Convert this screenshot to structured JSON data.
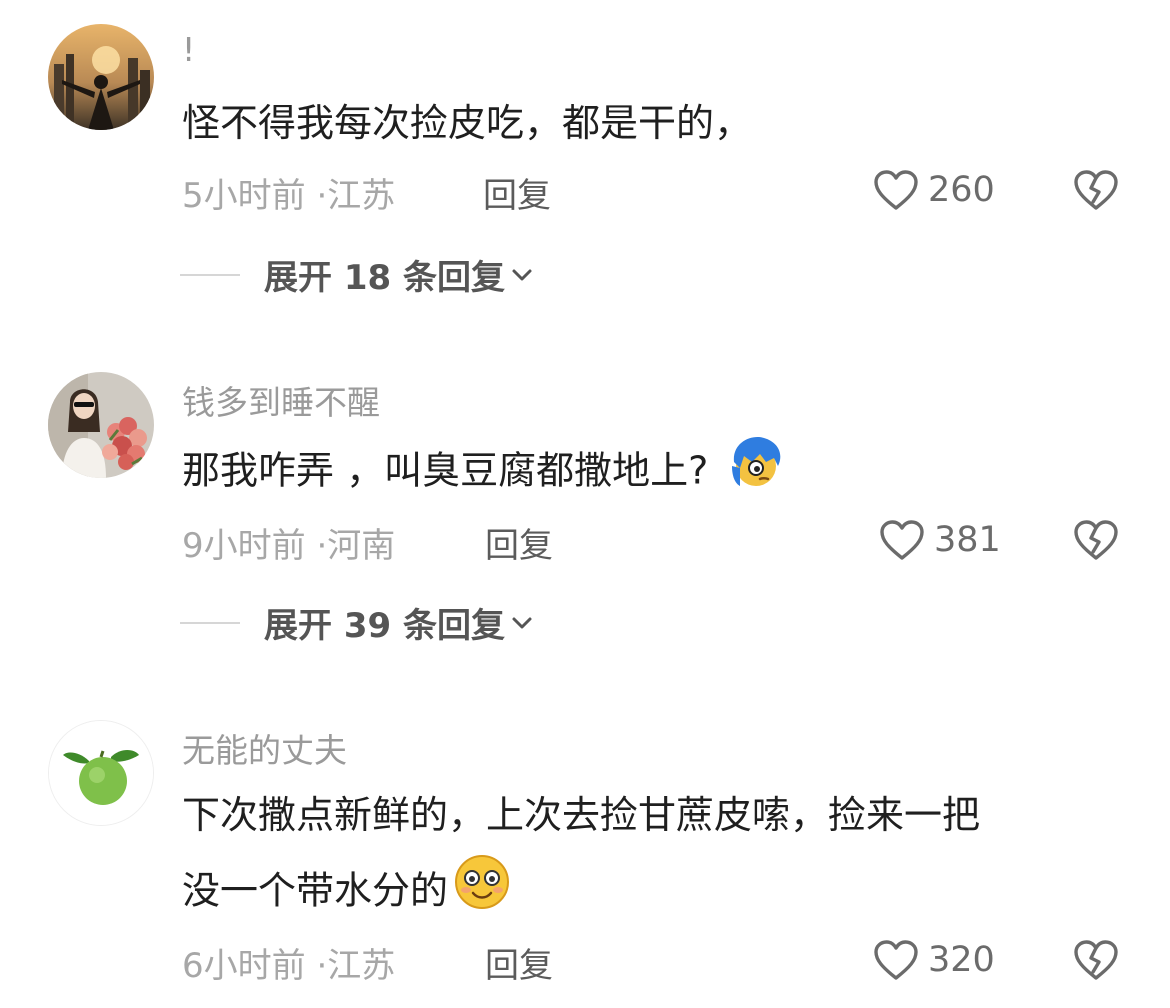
{
  "comments": [
    {
      "username": "!",
      "text": "怪不得我每次捡皮吃，都是干的，",
      "time": "5小时前",
      "location": "江苏",
      "reply_label": "回复",
      "likes": "260",
      "expand_prefix": "展开",
      "expand_count": "18",
      "expand_suffix": "条回复"
    },
    {
      "username": "钱多到睡不醒",
      "text": "那我咋弄 ，叫臭豆腐都撒地上?",
      "time": "9小时前",
      "location": "河南",
      "reply_label": "回复",
      "likes": "381",
      "expand_prefix": "展开",
      "expand_count": "39",
      "expand_suffix": "条回复"
    },
    {
      "username": "无能的丈夫",
      "text_line1": "下次撒点新鲜的，上次去捡甘蔗皮嗦，捡来一把",
      "text_line2": "没一个带水分的",
      "time": "6小时前",
      "location": "江苏",
      "reply_label": "回复",
      "likes": "320"
    }
  ],
  "meta_separator": "·",
  "icons": {
    "like": "heart-outline-icon",
    "dislike": "broken-heart-icon",
    "expand": "chevron-down-icon"
  }
}
